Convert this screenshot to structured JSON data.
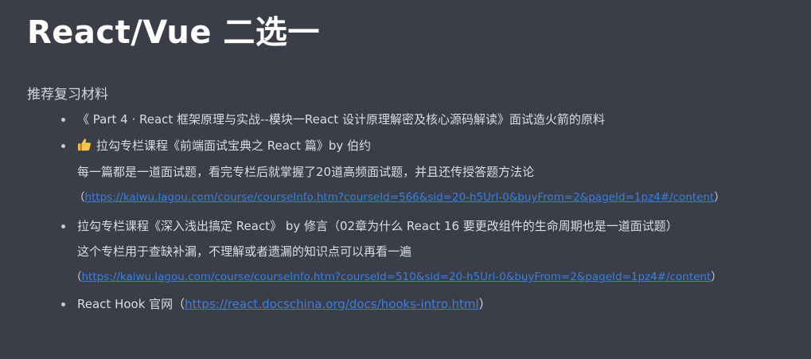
{
  "title": "React/Vue 二选一",
  "section_heading": "推荐复习材料",
  "items": [
    {
      "text": "《 Part 4 · React 框架原理与实战--模块一React 设计原理解密及核心源码解读》面试造火箭的原料"
    },
    {
      "icon": "thumbs-up-icon",
      "text": "拉勾专栏课程《前端面试宝典之 React 篇》by 伯约",
      "sub": "每一篇都是一道面试题，看完专栏后就掌握了20道高频面试题，并且还传授答题方法论",
      "link_open": "（",
      "link": "https://kaiwu.lagou.com/course/courseInfo.htm?courseId=566&sid=20-h5Url-0&buyFrom=2&pageId=1pz4#/content",
      "link_close": "）"
    },
    {
      "text": "拉勾专栏课程《深入浅出搞定 React》 by 修言（02章为什么 React 16 要更改组件的生命周期也是一道面试题）",
      "sub": "这个专栏用于查缺补漏，不理解或者遗漏的知识点可以再看一遍",
      "link_open": "（",
      "link": "https://kaiwu.lagou.com/course/courseInfo.htm?courseId=510&sid=20-h5Url-0&buyFrom=2&pageId=1pz4#/content",
      "link_close": "）"
    },
    {
      "text": "React Hook 官网（",
      "link": "https://react.docschina.org/docs/hooks-intro.html",
      "link_close": "）"
    }
  ],
  "colors": {
    "background": "#3b3e49",
    "title": "#ffffff",
    "body_text": "#dcdde2",
    "link": "#3a7fe0"
  }
}
